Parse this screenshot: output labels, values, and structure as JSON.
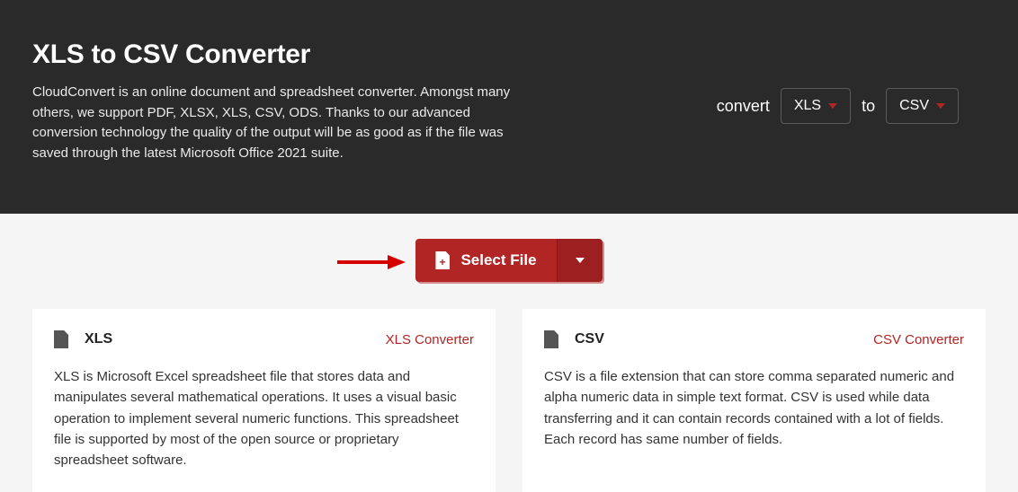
{
  "hero": {
    "title": "XLS to CSV Converter",
    "description": "CloudConvert is an online document and spreadsheet converter. Amongst many others, we support PDF, XLSX, XLS, CSV, ODS. Thanks to our advanced conversion technology the quality of the output will be as good as if the file was saved through the latest Microsoft Office 2021 suite.",
    "convert_label": "convert",
    "to_label": "to",
    "from_format": "XLS",
    "to_format": "CSV"
  },
  "select": {
    "button_label": "Select File"
  },
  "cards": [
    {
      "format": "XLS",
      "link_label": "XLS Converter",
      "body": "XLS is Microsoft Excel spreadsheet file that stores data and manipulates several mathematical operations. It uses a visual basic operation to implement several numeric functions. This spreadsheet file is supported by most of the open source or proprietary spreadsheet software."
    },
    {
      "format": "CSV",
      "link_label": "CSV Converter",
      "body": "CSV is a file extension that can store comma separated numeric and alpha numeric data in simple text format. CSV is used while data transferring and it can contain records contained with a lot of fields. Each record has same number of fields."
    }
  ]
}
